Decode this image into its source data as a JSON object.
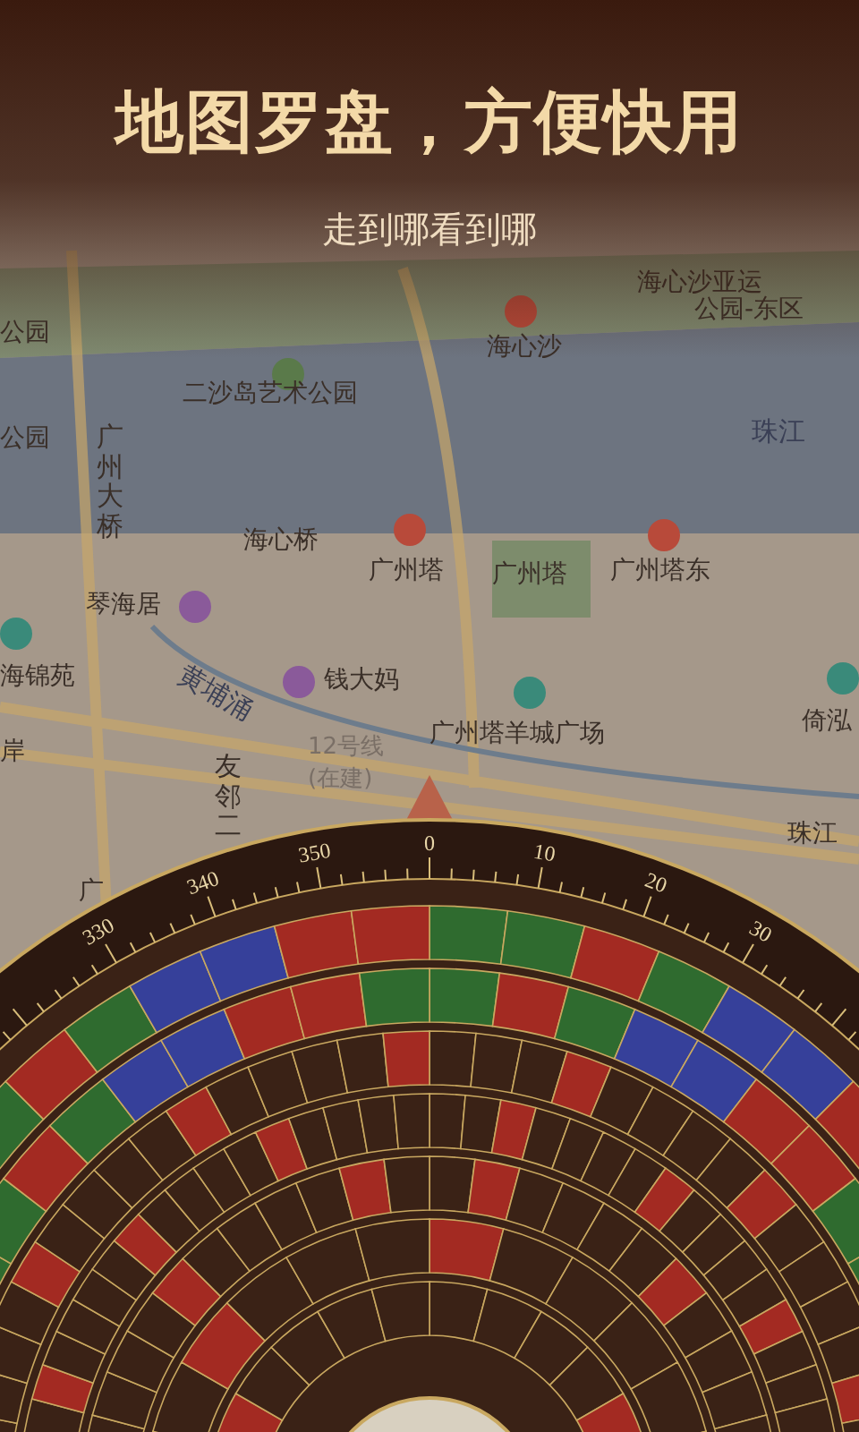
{
  "headline": "地图罗盘，方便快用",
  "subtitle": "走到哪看到哪",
  "map": {
    "labels": [
      {
        "text": "海心沙",
        "kind": "place"
      },
      {
        "text": "海心沙亚运",
        "kind": "place"
      },
      {
        "text": "公园-东区",
        "kind": "place"
      },
      {
        "text": "公园",
        "kind": "place"
      },
      {
        "text": "二沙岛艺术公园",
        "kind": "place"
      },
      {
        "text": "公园",
        "kind": "place"
      },
      {
        "text": "广州大桥",
        "kind": "vertical"
      },
      {
        "text": "珠江",
        "kind": "water"
      },
      {
        "text": "海心桥",
        "kind": "place"
      },
      {
        "text": "广州塔",
        "kind": "place"
      },
      {
        "text": "广州塔",
        "kind": "place"
      },
      {
        "text": "广州塔东",
        "kind": "place"
      },
      {
        "text": "琴海居",
        "kind": "place"
      },
      {
        "text": "海锦苑",
        "kind": "place"
      },
      {
        "text": "钱大妈",
        "kind": "place"
      },
      {
        "text": "黄埔涌",
        "kind": "water"
      },
      {
        "text": "广州塔羊城广场",
        "kind": "place"
      },
      {
        "text": "倚泓",
        "kind": "place"
      },
      {
        "text": "岸",
        "kind": "place"
      },
      {
        "text": "友邻二",
        "kind": "vertical"
      },
      {
        "text": "12号线",
        "kind": "line"
      },
      {
        "text": "(在建)",
        "kind": "line"
      },
      {
        "text": "珠江",
        "kind": "place"
      },
      {
        "text": "广",
        "kind": "place"
      }
    ]
  },
  "compass": {
    "degree_labels": [
      "330",
      "340",
      "350",
      "0",
      "10",
      "20",
      "30"
    ]
  }
}
